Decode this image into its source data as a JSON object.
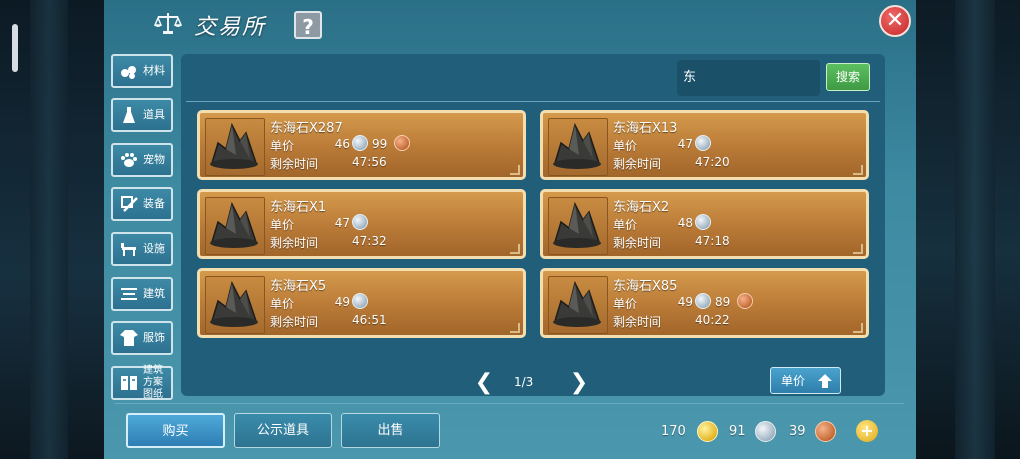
{
  "window": {
    "title": "交易所",
    "help_label": "?",
    "close_label": "✕"
  },
  "nav": {
    "items": [
      {
        "label": "材料",
        "icon": "materials-icon"
      },
      {
        "label": "道具",
        "icon": "props-icon"
      },
      {
        "label": "宠物",
        "icon": "pet-paw-icon"
      },
      {
        "label": "装备",
        "icon": "equipment-icon"
      },
      {
        "label": "设施",
        "icon": "facility-icon"
      },
      {
        "label": "建筑",
        "icon": "building-icon"
      },
      {
        "label": "服饰",
        "icon": "clothing-icon"
      },
      {
        "label": "建筑方案图纸",
        "icon": "blueprint-icon"
      }
    ]
  },
  "search": {
    "value": "东",
    "button_label": "搜索"
  },
  "labels": {
    "unit_price": "单价",
    "time_left": "剩余时间"
  },
  "listings": [
    {
      "name": "东海石X287",
      "silver": "46",
      "copper": "99",
      "time": "47:56"
    },
    {
      "name": "东海石X13",
      "silver": "47",
      "copper": "",
      "time": "47:20"
    },
    {
      "name": "东海石X1",
      "silver": "47",
      "copper": "",
      "time": "47:32"
    },
    {
      "name": "东海石X2",
      "silver": "48",
      "copper": "",
      "time": "47:18"
    },
    {
      "name": "东海石X5",
      "silver": "49",
      "copper": "",
      "time": "46:51"
    },
    {
      "name": "东海石X85",
      "silver": "49",
      "copper": "89",
      "time": "40:22"
    }
  ],
  "pagination": {
    "prev": "❮",
    "next": "❯",
    "current": "1/3"
  },
  "sort": {
    "label": "单价"
  },
  "tabs": {
    "buy": "购买",
    "public": "公示道具",
    "sell": "出售"
  },
  "currency": {
    "gold": "170",
    "silver": "91",
    "copper": "39",
    "add_label": "+"
  },
  "colors": {
    "panel": "#205e7a",
    "card": "#c58a40",
    "card_border": "#f3deb0",
    "search_button": "#4fae54",
    "close_button": "#d43a3a"
  }
}
